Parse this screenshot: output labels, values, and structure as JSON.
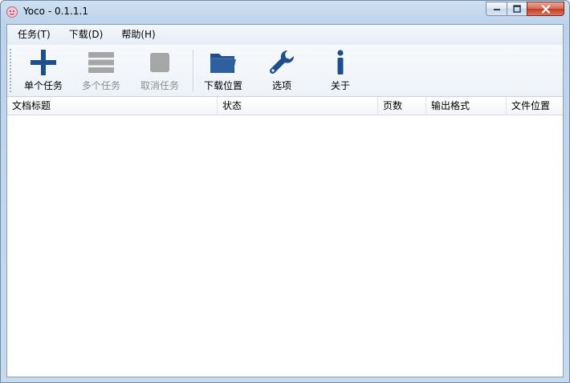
{
  "window": {
    "title": "Yoco - 0.1.1.1",
    "caption_buttons": {
      "minimize": "minimize-icon",
      "maximize": "maximize-icon",
      "close": "close-icon"
    }
  },
  "menu": {
    "items": [
      {
        "label": "任务(T)"
      },
      {
        "label": "下载(D)"
      },
      {
        "label": "帮助(H)"
      }
    ]
  },
  "toolbar": {
    "buttons": [
      {
        "label": "单个任务",
        "icon": "plus-icon",
        "enabled": true
      },
      {
        "label": "多个任务",
        "icon": "list-icon",
        "enabled": false
      },
      {
        "label": "取消任务",
        "icon": "stop-icon",
        "enabled": false
      },
      {
        "label": "下载位置",
        "icon": "folder-icon",
        "enabled": true
      },
      {
        "label": "选项",
        "icon": "wrench-icon",
        "enabled": true
      },
      {
        "label": "关于",
        "icon": "info-icon",
        "enabled": true
      }
    ],
    "colors": {
      "icon_active": "#1f4e8c",
      "icon_disabled": "#a6a6a6"
    }
  },
  "list": {
    "columns": [
      {
        "label": "文档标题"
      },
      {
        "label": "状态"
      },
      {
        "label": "页数"
      },
      {
        "label": "输出格式"
      },
      {
        "label": "文件位置"
      }
    ],
    "rows": []
  }
}
